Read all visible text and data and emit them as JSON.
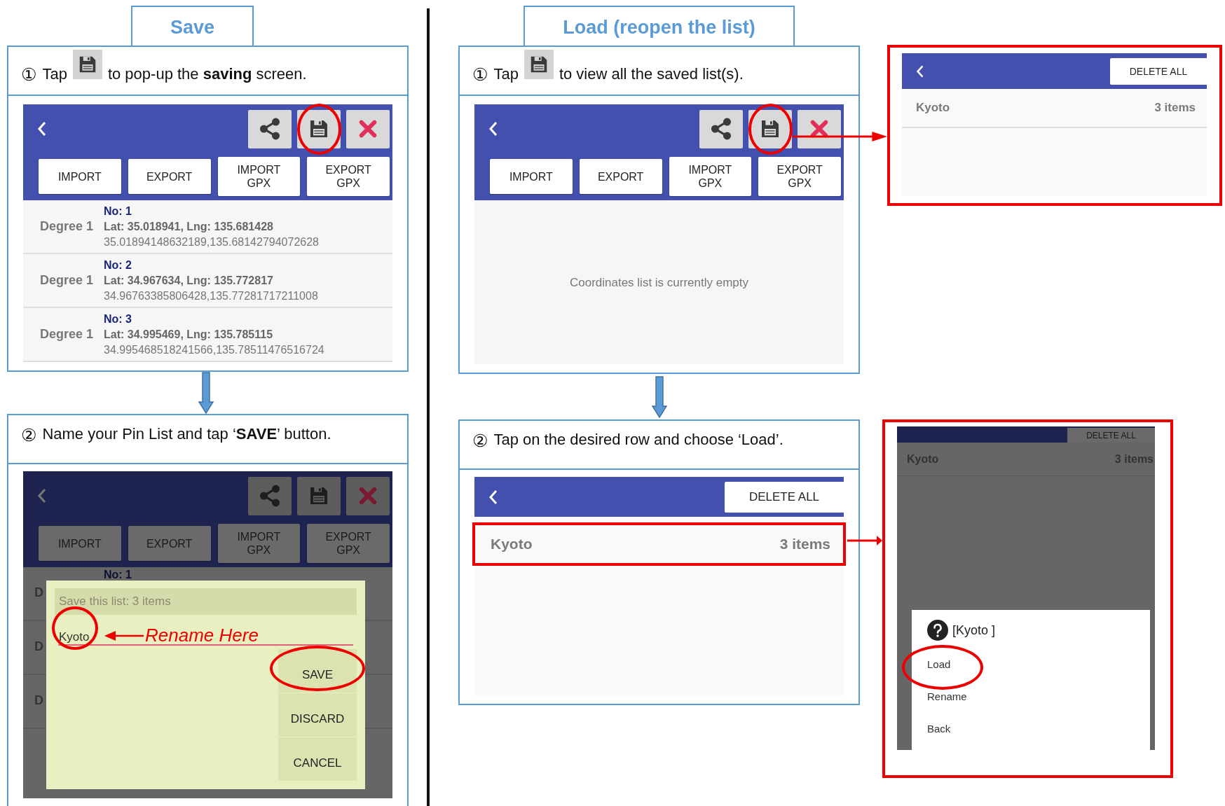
{
  "sections": [
    {
      "heading": "Save",
      "steps": [
        {
          "number": "①",
          "before": "Tap",
          "after": "to pop-up the **saving** screen.",
          "screen": {
            "kind": "pin-list",
            "tools": [
              {
                "kind": "share",
                "circled": false
              },
              {
                "kind": "save",
                "circled": true
              },
              {
                "kind": "close",
                "circled": false
              }
            ],
            "buttons": [
              "IMPORT",
              "EXPORT",
              "IMPORT\nGPX",
              "EXPORT\nGPX"
            ],
            "rows": [
              {
                "label": "Degree 1",
                "no": "No: 1",
                "latlng": "Lat: 35.018941, Lng: 135.681428",
                "raw": "35.01894148632189,135.68142794072628"
              },
              {
                "label": "Degree 1",
                "no": "No: 2",
                "latlng": "Lat: 34.967634, Lng: 135.772817",
                "raw": "34.96763385806428,135.77281717211008"
              },
              {
                "label": "Degree 1",
                "no": "No: 3",
                "latlng": "Lat: 34.995469, Lng: 135.785115",
                "raw": "34.995468518241566,135.78511476516724"
              }
            ]
          }
        },
        {
          "number": "②",
          "text": "Name your Pin List and tap ‘**SAVE**’ button.",
          "screen": {
            "kind": "save-dialog",
            "tools": [
              {
                "kind": "share",
                "circled": false
              },
              {
                "kind": "save",
                "circled": false
              },
              {
                "kind": "close",
                "circled": false
              }
            ],
            "buttons": [
              "IMPORT",
              "EXPORT",
              "IMPORT\nGPX",
              "EXPORT\nGPX"
            ],
            "rows": [
              {
                "label": "D",
                "no": "No: 1"
              },
              {
                "label": "D"
              },
              {
                "label": "D"
              }
            ],
            "dialog": {
              "title": "Save this list: 3 items",
              "value": "Kyoto",
              "value_circled": true,
              "annotation": "Rename Here",
              "actions": [
                {
                  "label": "SAVE",
                  "circled": true
                },
                {
                  "label": "DISCARD",
                  "circled": false
                },
                {
                  "label": "CANCEL",
                  "circled": false
                }
              ]
            }
          }
        }
      ]
    },
    {
      "heading": "Load (reopen the list)",
      "steps": [
        {
          "number": "①",
          "before": "Tap",
          "after": "to view all the saved list(s).",
          "screen": {
            "kind": "pin-list",
            "tools": [
              {
                "kind": "share",
                "circled": false
              },
              {
                "kind": "save",
                "circled": true
              },
              {
                "kind": "close",
                "circled": false
              }
            ],
            "buttons": [
              "IMPORT",
              "EXPORT",
              "IMPORT\nGPX",
              "EXPORT\nGPX"
            ],
            "empty_message": "Coordinates list is currently empty"
          },
          "callout": {
            "kind": "saved-lists",
            "action": "DELETE ALL",
            "lists": [
              {
                "name": "Kyoto",
                "count": "3 items",
                "highlighted": false
              }
            ]
          }
        },
        {
          "number": "②",
          "text": "Tap on the desired row and choose ‘Load’.",
          "screen": {
            "kind": "saved-lists",
            "action": "DELETE ALL",
            "lists": [
              {
                "name": "Kyoto",
                "count": "3 items",
                "highlighted": true
              }
            ]
          },
          "callout": {
            "kind": "load-menu",
            "action": "DELETE ALL",
            "lists": [
              {
                "name": "Kyoto",
                "count": "3 items"
              }
            ],
            "menu": {
              "title": "[Kyoto ]",
              "items": [
                {
                  "label": "Load",
                  "circled": true
                },
                {
                  "label": "Rename",
                  "circled": false
                },
                {
                  "label": "Back",
                  "circled": false
                }
              ]
            }
          }
        }
      ]
    }
  ]
}
